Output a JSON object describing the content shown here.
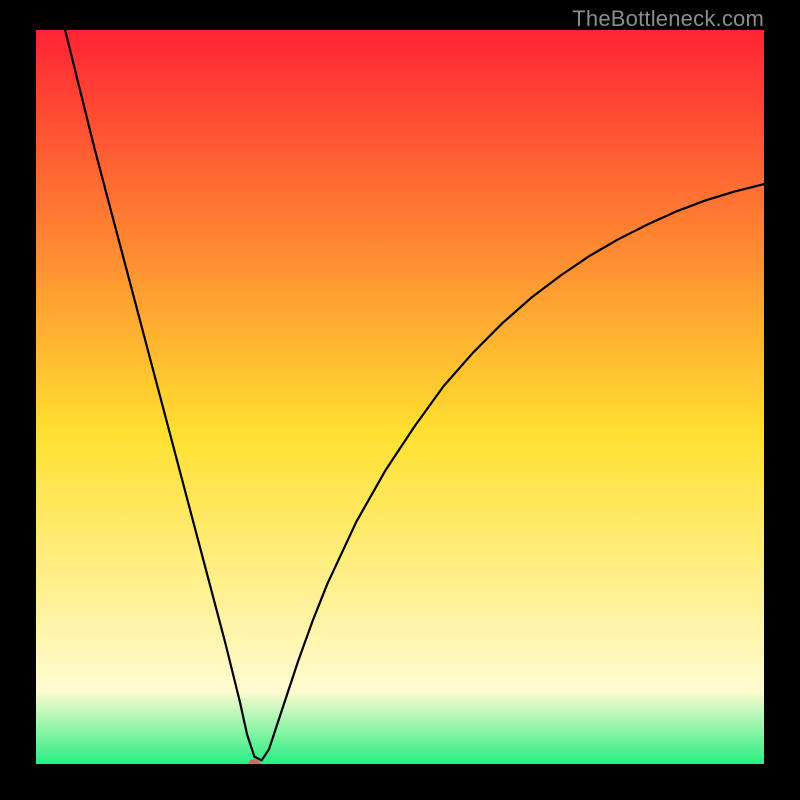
{
  "watermark": "TheBottleneck.com",
  "chart_data": {
    "type": "line",
    "title": "",
    "xlabel": "",
    "ylabel": "",
    "xlim": [
      0,
      100
    ],
    "ylim": [
      0,
      100
    ],
    "background_gradient": {
      "top_color": "#ff2434",
      "mid_color": "#ffe030",
      "near_bottom_color": "#fffbd0",
      "bottom_color": "#28ee84"
    },
    "series": [
      {
        "name": "bottleneck-curve",
        "x": [
          4,
          6,
          8,
          10,
          12,
          14,
          16,
          18,
          20,
          22,
          24,
          26,
          27,
          28,
          29,
          30,
          31,
          32,
          34,
          36,
          38,
          40,
          44,
          48,
          52,
          56,
          60,
          64,
          68,
          72,
          76,
          80,
          84,
          88,
          92,
          96,
          100
        ],
        "values": [
          100,
          92,
          84,
          76.5,
          69,
          61.5,
          54,
          46.5,
          39,
          31.5,
          24,
          16.5,
          12.5,
          8.5,
          4,
          1,
          0.5,
          2,
          8,
          14,
          19.5,
          24.5,
          33,
          40,
          46,
          51.5,
          56,
          60,
          63.5,
          66.5,
          69.2,
          71.5,
          73.5,
          75.3,
          76.8,
          78,
          79
        ]
      }
    ],
    "marker": {
      "x": 30,
      "y": 0,
      "rx": 6,
      "ry": 5,
      "color": "#d86a5d"
    },
    "grid": false,
    "legend": {
      "position": "none"
    }
  }
}
